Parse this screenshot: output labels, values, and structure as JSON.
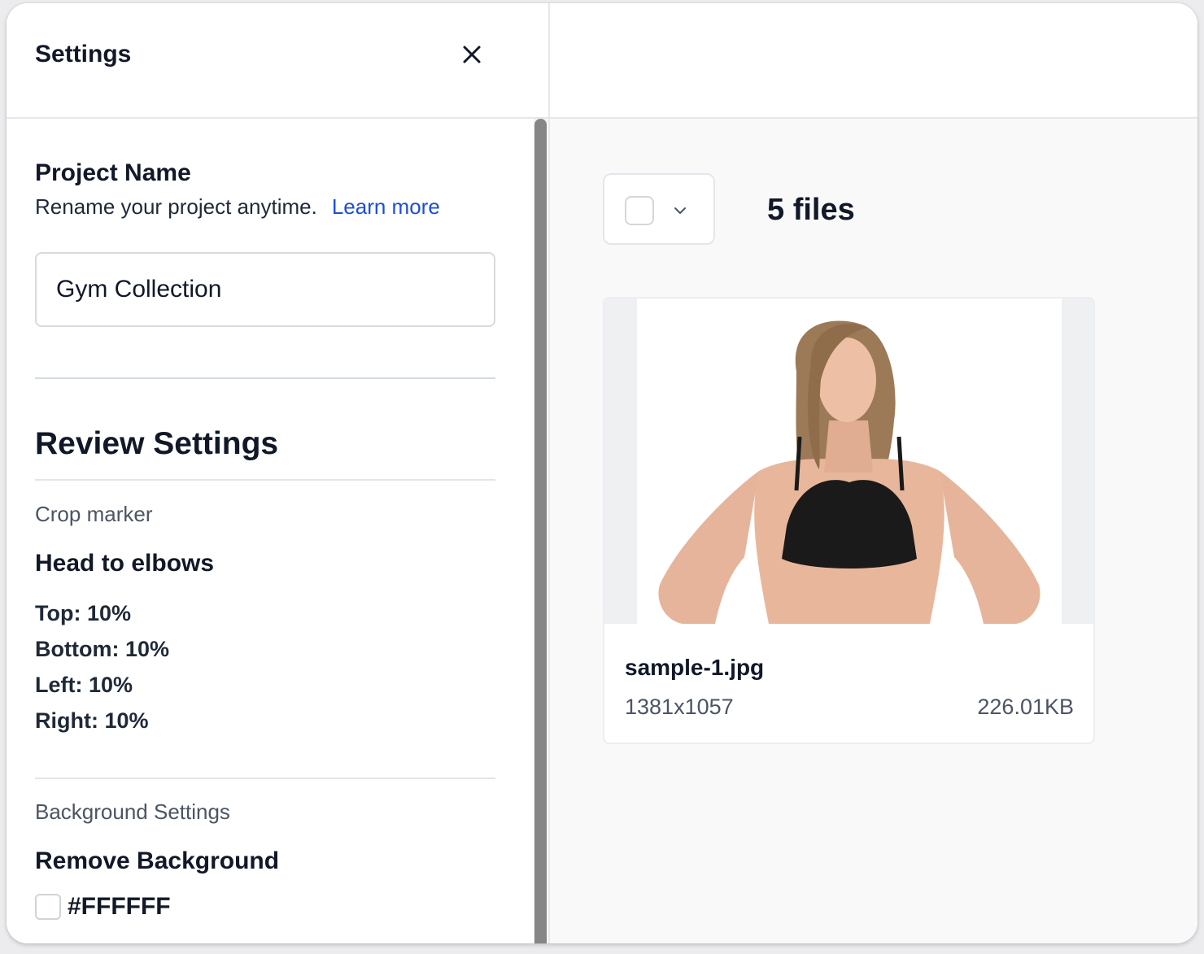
{
  "settings": {
    "title": "Settings",
    "project": {
      "heading": "Project Name",
      "description": "Rename your project anytime.",
      "learn_more": "Learn more",
      "name_value": "Gym Collection"
    },
    "review": {
      "heading": "Review Settings",
      "crop_label": "Crop marker",
      "crop_preset": "Head to elbows",
      "crop_values": [
        "Top: 10%",
        "Bottom: 10%",
        "Left: 10%",
        "Right: 10%"
      ]
    },
    "background": {
      "label": "Background Settings",
      "heading": "Remove Background",
      "color_value": "#FFFFFF",
      "checked": false
    }
  },
  "files": {
    "count_label": "5 files",
    "items": [
      {
        "name": "sample-1.jpg",
        "dimensions": "1381x1057",
        "size": "226.01KB"
      }
    ]
  },
  "colors": {
    "link": "#1d4ed8",
    "text": "#111827",
    "muted": "#4b5563"
  },
  "icons": [
    "close-icon",
    "chevron-down-icon",
    "image-thumbnail"
  ]
}
